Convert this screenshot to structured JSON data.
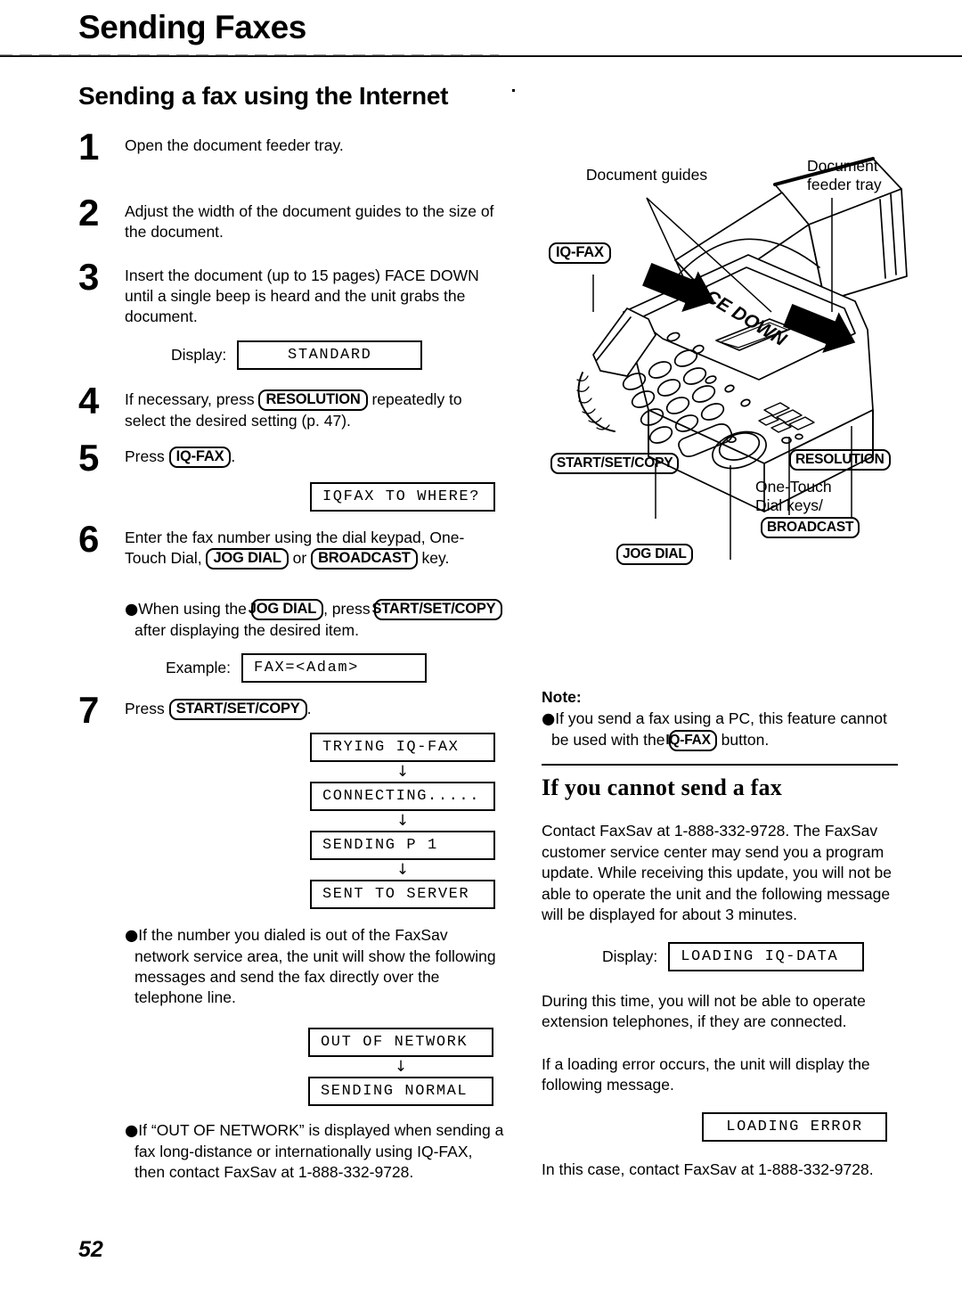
{
  "header": {
    "chapter_title": "Sending Faxes",
    "section_title": "Sending a fax using the Internet"
  },
  "steps": [
    {
      "num": "1",
      "text": "Open the document feeder tray."
    },
    {
      "num": "2",
      "text": "Adjust the width of the document guides to the size of the document."
    },
    {
      "num": "3",
      "text": "Insert the document (up to 15 pages) FACE DOWN until a single beep is heard and the unit grabs the document."
    },
    {
      "num": "4",
      "text_before": "If necessary, press ",
      "key": "RESOLUTION",
      "text_after": " repeatedly to select the desired setting (p. 47)."
    },
    {
      "num": "5",
      "text_before": "Press ",
      "key": "IQ-FAX",
      "text_after": "."
    },
    {
      "num": "6",
      "text_before": "Enter the fax number using the dial keypad, One-Touch Dial, ",
      "key1": "JOG DIAL",
      "text_mid": " or ",
      "key2": "BROADCAST",
      "text_after": " key."
    },
    {
      "num": "7",
      "text_before": "Press ",
      "key": "START/SET/COPY",
      "text_after": "."
    }
  ],
  "step3_display": {
    "label": "Display:",
    "value": "STANDARD"
  },
  "step5_display": {
    "value": "IQFAX TO WHERE?"
  },
  "step6_bullet": {
    "before": "When using the ",
    "key1": "JOG DIAL",
    "mid": ", press ",
    "key2": "START/SET/COPY",
    "after": " after displaying the desired item."
  },
  "step6_example": {
    "label": "Example:",
    "value": "FAX=<Adam>"
  },
  "step7_sequence": [
    "TRYING IQ-FAX",
    "CONNECTING.....",
    "SENDING P 1",
    "SENT TO SERVER"
  ],
  "out_of_network": {
    "bullet": "If the number you dialed is out of the FaxSav network service area, the unit will show the following messages and send the fax directly over the telephone line.",
    "sequence": [
      "OUT OF NETWORK",
      "SENDING NORMAL"
    ],
    "bullet2": "If “OUT OF NETWORK” is displayed when sending a fax long-distance or internationally using IQ-FAX, then contact FaxSav at 1-888-332-9728."
  },
  "figure": {
    "label_document_guides": "Document guides",
    "label_feeder_tray_line1": "Document",
    "label_feeder_tray_line2": "feeder tray",
    "key_iq_fax": "IQ-FAX",
    "face_down": "FACE DOWN",
    "key_start_set_copy": "START/SET/COPY",
    "key_resolution": "RESOLUTION",
    "label_one_touch_line1": "One-Touch",
    "label_one_touch_line2": "Dial keys/",
    "key_broadcast": "BROADCAST",
    "key_jog_dial": "JOG DIAL"
  },
  "note": {
    "label": "Note:",
    "before": "If you send a fax using a PC, this feature cannot be used with the ",
    "key": "IQ-FAX",
    "after": " button."
  },
  "cannot_send": {
    "heading": "If you cannot send a fax",
    "para1": "Contact FaxSav at 1-888-332-9728. The FaxSav customer service center may send you a program update. While receiving this update, you will not be able to operate the unit and the following message will be displayed for about 3 minutes.",
    "display_label": "Display:",
    "display_value": "LOADING IQ-DATA",
    "para2": "During this time, you will not be able to operate extension telephones, if they are connected.",
    "para3": "If a loading error occurs, the unit will display the following message.",
    "error_value": "LOADING ERROR",
    "para4": "In this case, contact FaxSav at 1-888-332-9728."
  },
  "page_number": "52"
}
